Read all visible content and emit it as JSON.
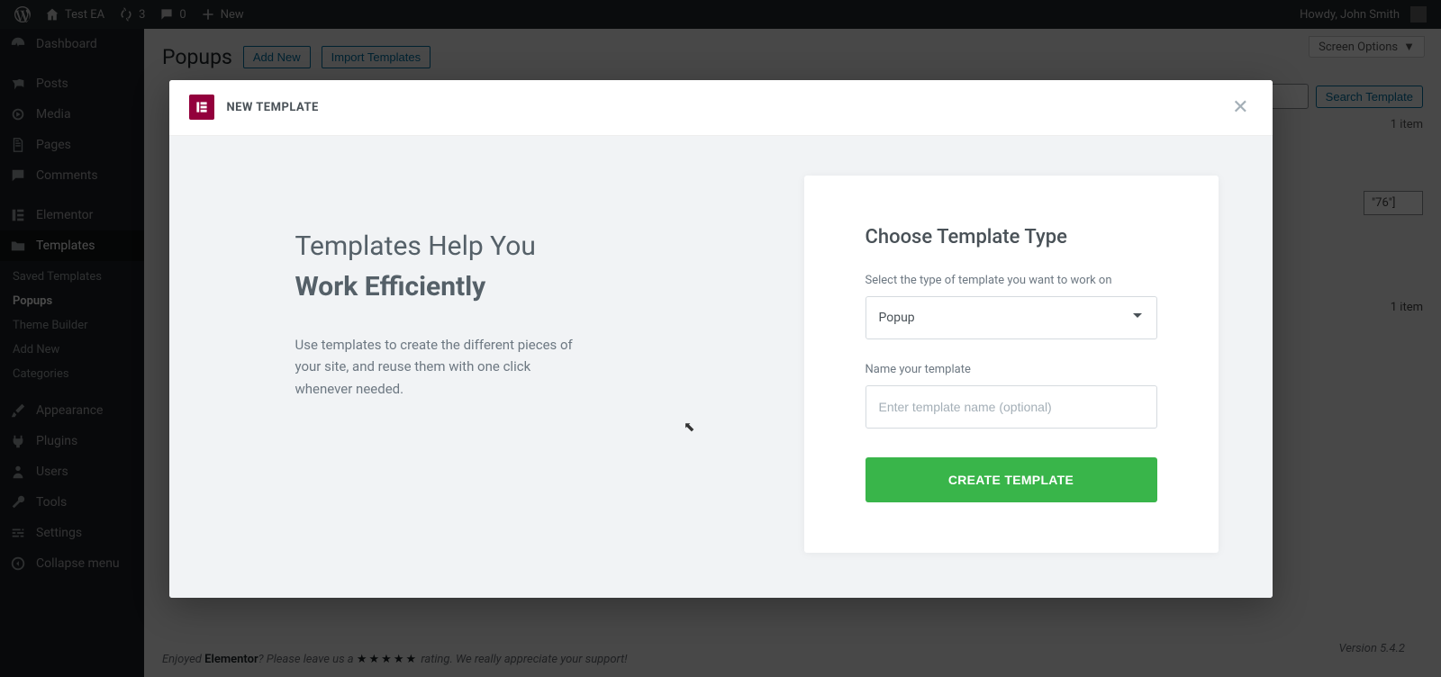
{
  "adminbar": {
    "site_name": "Test EA",
    "updates_count": "3",
    "comments_count": "0",
    "new_label": "New",
    "greeting": "Howdy, John Smith"
  },
  "sidebar": {
    "items": [
      {
        "label": "Dashboard"
      },
      {
        "label": "Posts"
      },
      {
        "label": "Media"
      },
      {
        "label": "Pages"
      },
      {
        "label": "Comments"
      },
      {
        "label": "Elementor"
      },
      {
        "label": "Templates"
      },
      {
        "label": "Appearance"
      },
      {
        "label": "Plugins"
      },
      {
        "label": "Users"
      },
      {
        "label": "Tools"
      },
      {
        "label": "Settings"
      },
      {
        "label": "Collapse menu"
      }
    ],
    "submenu": [
      {
        "label": "Saved Templates"
      },
      {
        "label": "Popups"
      },
      {
        "label": "Theme Builder"
      },
      {
        "label": "Add New"
      },
      {
        "label": "Categories"
      }
    ]
  },
  "page": {
    "screen_options": "Screen Options",
    "title": "Popups",
    "add_new": "Add New",
    "import_templates": "Import Templates",
    "search_button": "Search Template",
    "item_count": "1 item",
    "shortcode_fragment": "\"76\"]",
    "footer_prefix": "Enjoyed ",
    "footer_brand": "Elementor",
    "footer_mid": "? Please leave us a ",
    "footer_suffix": " rating. We really appreciate your support!",
    "version": "Version 5.4.2"
  },
  "modal": {
    "header_title": "NEW TEMPLATE",
    "left_heading_line1": "Templates Help You",
    "left_heading_line2": "Work Efficiently",
    "left_paragraph": "Use templates to create the different pieces of your site, and reuse them with one click whenever needed.",
    "form_title": "Choose Template Type",
    "type_label": "Select the type of template you want to work on",
    "type_value": "Popup",
    "name_label": "Name your template",
    "name_placeholder": "Enter template name (optional)",
    "submit_label": "CREATE TEMPLATE"
  }
}
